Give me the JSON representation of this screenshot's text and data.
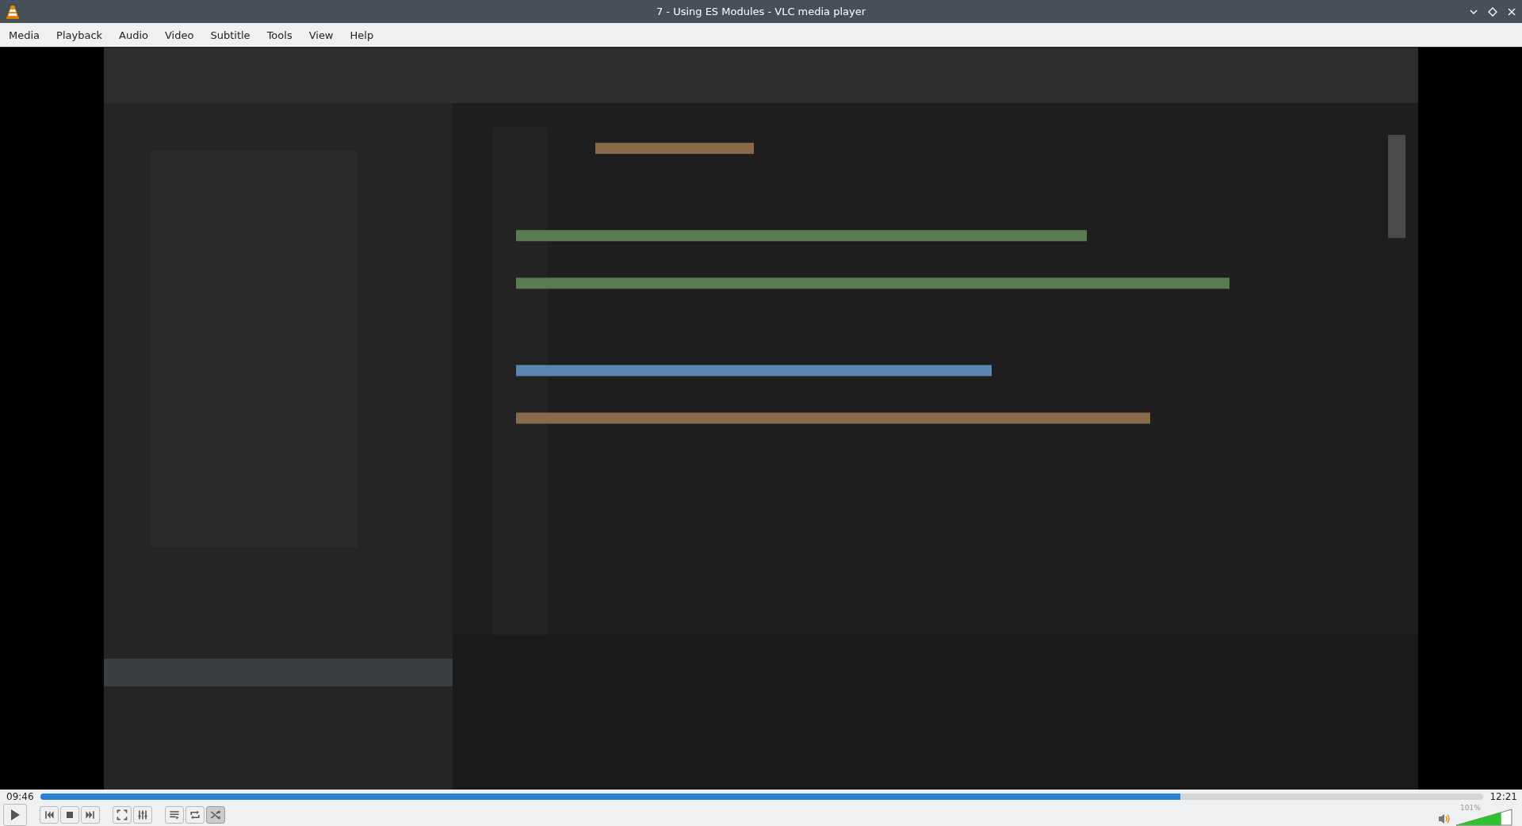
{
  "window": {
    "title": "7 - Using ES Modules - VLC media player"
  },
  "menu": [
    "Media",
    "Playback",
    "Audio",
    "Video",
    "Subtitle",
    "Tools",
    "View",
    "Help"
  ],
  "seek": {
    "elapsed": "09:46",
    "total": "12:21",
    "level": 0.79
  },
  "controls": [
    {
      "kind": "play",
      "on": false
    },
    {
      "kind": "gap"
    },
    {
      "kind": "previous",
      "on": false
    },
    {
      "kind": "stop",
      "on": false
    },
    {
      "kind": "next",
      "on": false
    },
    {
      "kind": "gap"
    },
    {
      "kind": "fullscreen",
      "on": false
    },
    {
      "kind": "extended",
      "on": false
    },
    {
      "kind": "gap"
    },
    {
      "kind": "playlist",
      "on": false
    },
    {
      "kind": "loop",
      "on": false
    },
    {
      "kind": "shuffle",
      "on": true
    }
  ],
  "volume": {
    "reading": "101%",
    "level": 0.81
  }
}
